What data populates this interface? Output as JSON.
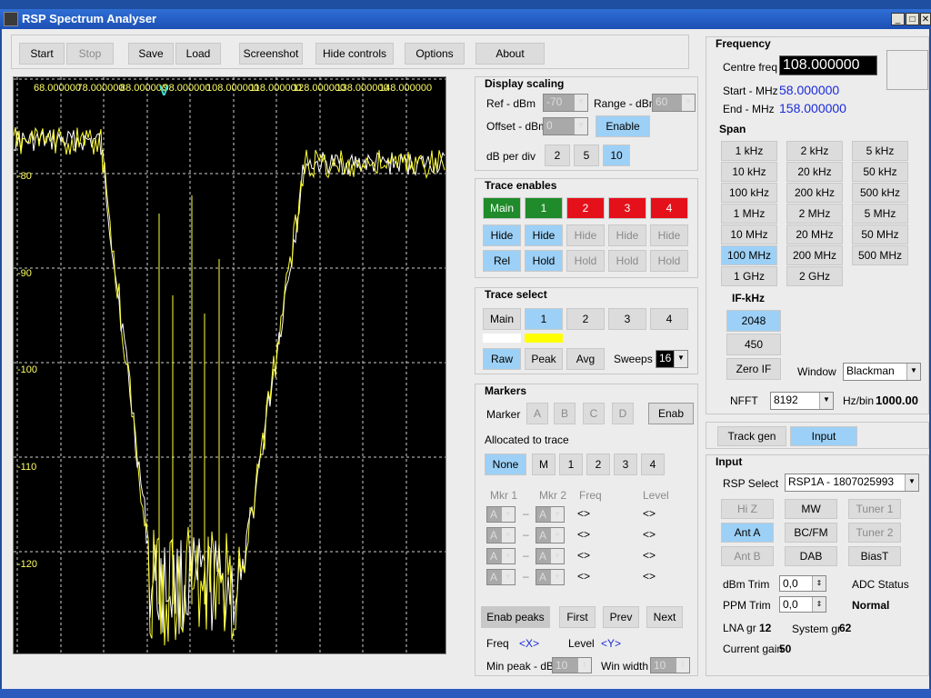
{
  "window": {
    "title": "RSP Spectrum Analyser"
  },
  "toolbar": {
    "start": "Start",
    "stop": "Stop",
    "save": "Save",
    "load": "Load",
    "screenshot": "Screenshot",
    "hide_controls": "Hide controls",
    "options": "Options",
    "about": "About"
  },
  "plot": {
    "freq_labels": [
      "68.000000",
      "78.000000",
      "88.000000",
      "98.000000",
      "108.000000",
      "118.000000",
      "128.000000",
      "138.000000",
      "148.000000"
    ],
    "db_labels": [
      "-80",
      "-90",
      "-100",
      "-110",
      "-120"
    ],
    "marker_glyph": "V"
  },
  "display_scaling": {
    "title": "Display scaling",
    "ref_label": "Ref - dBm",
    "ref_value": "-70",
    "range_label": "Range - dBm",
    "range_value": "60",
    "offset_label": "Offset - dBm",
    "offset_value": "0",
    "enable": "Enable",
    "db_per_div_label": "dB per div",
    "db_opts": [
      "2",
      "5",
      "10"
    ]
  },
  "trace_enables": {
    "title": "Trace enables",
    "headers": [
      "Main",
      "1",
      "2",
      "3",
      "4"
    ],
    "hide": [
      "Hide",
      "Hide",
      "Hide",
      "Hide",
      "Hide"
    ],
    "row3": [
      "Rel",
      "Hold",
      "Hold",
      "Hold",
      "Hold"
    ]
  },
  "trace_select": {
    "title": "Trace select",
    "items": [
      "Main",
      "1",
      "2",
      "3",
      "4"
    ],
    "modes": [
      "Raw",
      "Peak",
      "Avg"
    ],
    "sweeps_label": "Sweeps",
    "sweeps_value": "16"
  },
  "markers": {
    "title": "Markers",
    "marker_label": "Marker",
    "letters": [
      "A",
      "B",
      "C",
      "D"
    ],
    "enab": "Enab",
    "allocated_label": "Allocated to trace",
    "alloc": [
      "None",
      "M",
      "1",
      "2",
      "3",
      "4"
    ],
    "col_mkr1": "Mkr 1",
    "col_mkr2": "Mkr 2",
    "col_freq": "Freq",
    "col_level": "Level",
    "sel_value": "A",
    "dash": "–",
    "placeholder": "<>",
    "enab_peaks": "Enab peaks",
    "first": "First",
    "prev": "Prev",
    "next": "Next",
    "freq_label": "Freq",
    "freq_val": "<X>",
    "level_label": "Level",
    "level_val": "<Y>",
    "min_peak_label": "Min peak - dB",
    "min_peak_value": "10",
    "win_width_label": "Win width",
    "win_width_value": "10"
  },
  "frequency": {
    "title": "Frequency",
    "centre_label": "Centre freq",
    "centre_value": "108.000000",
    "start_label": "Start - MHz",
    "start_value": "58.000000",
    "end_label": "End - MHz",
    "end_value": "158.000000",
    "span_title": "Span",
    "span": [
      "1 kHz",
      "2 kHz",
      "5 kHz",
      "10 kHz",
      "20 kHz",
      "50 kHz",
      "100 kHz",
      "200 kHz",
      "500 kHz",
      "1 MHz",
      "2 MHz",
      "5 MHz",
      "10 MHz",
      "20 MHz",
      "50 MHz",
      "100 MHz",
      "200 MHz",
      "500 MHz",
      "1 GHz",
      "2 GHz"
    ],
    "if_title": "IF-kHz",
    "if": [
      "2048",
      "450",
      "Zero IF"
    ],
    "window_label": "Window",
    "window_value": "Blackman",
    "nfft_label": "NFFT",
    "nfft_value": "8192",
    "hzbin_label": "Hz/bin",
    "hzbin_value": "1000.00"
  },
  "tabs": {
    "track_gen": "Track gen",
    "input": "Input"
  },
  "input": {
    "title": "Input",
    "rsp_label": "RSP Select",
    "rsp_value": "RSP1A - 1807025993",
    "buttons": [
      "Hi Z",
      "MW",
      "Tuner 1",
      "Ant A",
      "BC/FM",
      "Tuner 2",
      "Ant B",
      "DAB",
      "BiasT"
    ],
    "dbm_trim_label": "dBm Trim",
    "dbm_trim_value": "0,0",
    "ppm_trim_label": "PPM Trim",
    "ppm_trim_value": "0,0",
    "adc_label": "ADC Status",
    "adc_value": "Normal",
    "lna_label": "LNA gr",
    "lna_value": "12",
    "system_label": "System gr",
    "system_value": "62",
    "gain_label": "Current gain",
    "gain_value": "50"
  },
  "colors": {
    "trace_main": "#ffffff",
    "trace_1": "#ffff33",
    "grid": "#d8d8d8",
    "accent_blue": "#9dd0f6",
    "enabled_green": "#1f8b2a",
    "disabled_red": "#e4111b"
  }
}
